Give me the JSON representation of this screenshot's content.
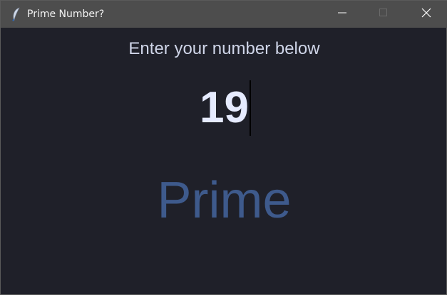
{
  "window": {
    "title": "Prime Number?",
    "icon": "feather-icon",
    "controls": {
      "minimize": "minimize-icon",
      "maximize": "maximize-icon",
      "close": "close-icon"
    }
  },
  "main": {
    "prompt": "Enter your number below",
    "input_value": "19",
    "result": "Prime"
  },
  "colors": {
    "background": "#1f2029",
    "titlebar": "#4d4d4d",
    "prompt_text": "#cfd5e8",
    "input_text": "#e6ebff",
    "result_text": "#3e5a8c"
  }
}
